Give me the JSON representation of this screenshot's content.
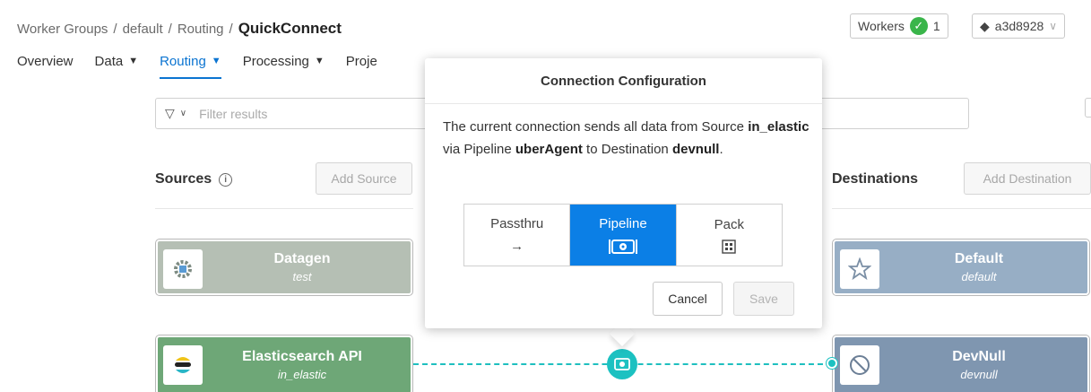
{
  "breadcrumb": {
    "items": [
      "Worker Groups",
      "default",
      "Routing"
    ],
    "separator": "/",
    "current": "QuickConnect"
  },
  "nav": {
    "items": [
      {
        "label": "Overview",
        "caret": ""
      },
      {
        "label": "Data",
        "caret": "▼"
      },
      {
        "label": "Routing",
        "caret": "▼"
      },
      {
        "label": "Processing",
        "caret": "▼"
      },
      {
        "label": "Proje",
        "caret": ""
      }
    ],
    "active": "Routing"
  },
  "workers": {
    "label": "Workers",
    "count": "1",
    "status_color": "#3ab54a"
  },
  "commit": {
    "hash": "a3d8928"
  },
  "filter": {
    "placeholder": "Filter results"
  },
  "sources": {
    "title": "Sources",
    "add_button": "Add Source",
    "items": [
      {
        "title": "Datagen",
        "subtitle": "test",
        "color": "#b5bfb4",
        "icon": "gear-icon"
      },
      {
        "title": "Elasticsearch API",
        "subtitle": "in_elastic",
        "color": "#6ea777",
        "icon": "elastic-icon"
      }
    ]
  },
  "destinations": {
    "title": "Destinations",
    "add_button": "Add Destination",
    "items": [
      {
        "title": "Default",
        "subtitle": "default",
        "color": "#97aec5",
        "icon": "star-icon"
      },
      {
        "title": "DevNull",
        "subtitle": "devnull",
        "color": "#7f96b0",
        "icon": "no-entry-icon"
      }
    ]
  },
  "modal": {
    "title": "Connection Configuration",
    "text_parts": {
      "p1": "The current connection sends all data from Source ",
      "source": "in_elastic",
      "p2": " via Pipeline ",
      "pipeline": "uberAgent",
      "p3": " to Destination ",
      "destination": "devnull",
      "p4": "."
    },
    "options": [
      {
        "label": "Passthru",
        "icon": "arrow-right-icon",
        "glyph": "→"
      },
      {
        "label": "Pipeline",
        "icon": "pipeline-icon",
        "selected": true
      },
      {
        "label": "Pack",
        "icon": "pack-icon"
      }
    ],
    "cancel": "Cancel",
    "save": "Save"
  },
  "colors": {
    "accent": "#0b74d1",
    "connection": "#1cc1c1"
  }
}
